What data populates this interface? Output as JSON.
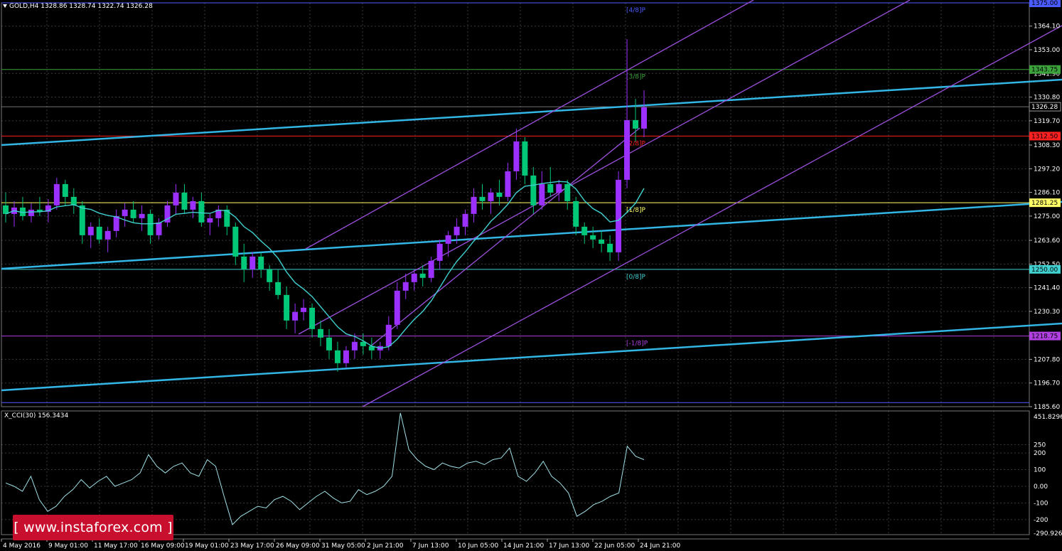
{
  "header": {
    "symbol_info": "GOLD,H4  1328.86 1328.74 1322.74 1326.28"
  },
  "indicator": {
    "label": "X_CCI(30) 156.3434"
  },
  "watermark": {
    "text": "[ www.instaforex.com ]"
  },
  "colors": {
    "background": "#000000",
    "grid": "#3a3a3a",
    "bull": "#9b30ff",
    "bear": "#00c878",
    "ma": "#40d0d0",
    "trend": "#33b5e5",
    "channel": "#9b4fdb",
    "cci": "#9fe0e8"
  },
  "chart_data": [
    {
      "type": "candlestick",
      "ylim": [
        1185.6,
        1375.0
      ],
      "price_ticks": [
        "1364.10",
        "1353.00",
        "1341.90",
        "1330.80",
        "1319.70",
        "1308.30",
        "1297.20",
        "1286.10",
        "1275.00",
        "1263.60",
        "1252.50",
        "1241.40",
        "1230.30",
        "1207.80",
        "1196.70",
        "1185.60"
      ],
      "time_ticks": [
        "4 May 2016",
        "9 May 01:00",
        "11 May 17:00",
        "16 May 09:00",
        "19 May 01:00",
        "23 May 17:00",
        "26 May 09:00",
        "31 May 05:00",
        "2 Jun 21:00",
        "7 Jun 13:00",
        "10 Jun 05:00",
        "14 Jun 21:00",
        "17 Jun 13:00",
        "22 Jun 05:00",
        "24 Jun 21:00"
      ],
      "current_price": {
        "value": 1326.28,
        "label": "1326.28"
      },
      "levels": [
        {
          "value": 1375.0,
          "label": "1375.00",
          "tag": "[4/8]P",
          "color": "#4a5bff"
        },
        {
          "value": 1343.75,
          "label": "1343.75",
          "tag": "[3/8]P",
          "color": "#3ca33c"
        },
        {
          "value": 1312.5,
          "label": "1312.50",
          "tag": "[2/8]P",
          "color": "#ff2020"
        },
        {
          "value": 1281.25,
          "label": "1281.25",
          "tag": "[1/8]P",
          "color": "#ffff66"
        },
        {
          "value": 1250.0,
          "label": "1250.00",
          "tag": "[0/8]P",
          "color": "#40d0d0"
        },
        {
          "value": 1218.75,
          "label": "1218.75",
          "tag": "[-1/8]P",
          "color": "#b040e0"
        },
        {
          "value": 1187.5,
          "label": "",
          "tag": "",
          "color": "#4a5bff"
        }
      ],
      "series": [
        {
          "points": [
            [
              1280,
              1286,
              1272,
              1276
            ],
            [
              1276,
              1282,
              1270,
              1279
            ],
            [
              1279,
              1284,
              1273,
              1275
            ],
            [
              1275,
              1281,
              1272,
              1278
            ],
            [
              1278,
              1284,
              1275,
              1277
            ],
            [
              1277,
              1283,
              1272,
              1280
            ],
            [
              1280,
              1293,
              1278,
              1290
            ],
            [
              1290,
              1292,
              1280,
              1284
            ],
            [
              1284,
              1288,
              1276,
              1280
            ],
            [
              1280,
              1282,
              1262,
              1266
            ],
            [
              1266,
              1272,
              1260,
              1270
            ],
            [
              1270,
              1274,
              1262,
              1264
            ],
            [
              1264,
              1270,
              1258,
              1268
            ],
            [
              1268,
              1278,
              1265,
              1275
            ],
            [
              1275,
              1281,
              1270,
              1278
            ],
            [
              1278,
              1282,
              1272,
              1274
            ],
            [
              1274,
              1280,
              1268,
              1276
            ],
            [
              1276,
              1278,
              1262,
              1266
            ],
            [
              1266,
              1274,
              1264,
              1272
            ],
            [
              1272,
              1282,
              1270,
              1280
            ],
            [
              1280,
              1290,
              1276,
              1286
            ],
            [
              1286,
              1290,
              1276,
              1278
            ],
            [
              1278,
              1284,
              1274,
              1282
            ],
            [
              1282,
              1286,
              1270,
              1272
            ],
            [
              1272,
              1276,
              1266,
              1274
            ],
            [
              1274,
              1280,
              1270,
              1278
            ],
            [
              1278,
              1280,
              1266,
              1270
            ],
            [
              1270,
              1272,
              1252,
              1256
            ],
            [
              1256,
              1262,
              1244,
              1250
            ],
            [
              1250,
              1258,
              1246,
              1256
            ],
            [
              1256,
              1258,
              1246,
              1250
            ],
            [
              1250,
              1252,
              1240,
              1244
            ],
            [
              1244,
              1250,
              1236,
              1238
            ],
            [
              1238,
              1242,
              1222,
              1226
            ],
            [
              1226,
              1234,
              1220,
              1230
            ],
            [
              1230,
              1236,
              1226,
              1232
            ],
            [
              1232,
              1234,
              1218,
              1222
            ],
            [
              1222,
              1226,
              1214,
              1218
            ],
            [
              1218,
              1222,
              1208,
              1212
            ],
            [
              1212,
              1216,
              1202,
              1206
            ],
            [
              1206,
              1214,
              1204,
              1212
            ],
            [
              1212,
              1220,
              1208,
              1216
            ],
            [
              1216,
              1220,
              1210,
              1214
            ],
            [
              1214,
              1218,
              1208,
              1212
            ],
            [
              1212,
              1216,
              1208,
              1214
            ],
            [
              1214,
              1228,
              1212,
              1224
            ],
            [
              1224,
              1244,
              1222,
              1240
            ],
            [
              1240,
              1248,
              1236,
              1244
            ],
            [
              1244,
              1250,
              1240,
              1248
            ],
            [
              1248,
              1252,
              1242,
              1246
            ],
            [
              1246,
              1256,
              1244,
              1254
            ],
            [
              1254,
              1264,
              1250,
              1262
            ],
            [
              1262,
              1268,
              1256,
              1266
            ],
            [
              1266,
              1274,
              1262,
              1270
            ],
            [
              1270,
              1278,
              1266,
              1276
            ],
            [
              1276,
              1288,
              1272,
              1284
            ],
            [
              1284,
              1290,
              1278,
              1282
            ],
            [
              1282,
              1288,
              1276,
              1286
            ],
            [
              1286,
              1292,
              1280,
              1284
            ],
            [
              1284,
              1300,
              1282,
              1296
            ],
            [
              1296,
              1316,
              1292,
              1310
            ],
            [
              1310,
              1312,
              1290,
              1294
            ],
            [
              1294,
              1298,
              1276,
              1280
            ],
            [
              1280,
              1296,
              1278,
              1290
            ],
            [
              1290,
              1298,
              1284,
              1286
            ],
            [
              1286,
              1292,
              1282,
              1290
            ],
            [
              1290,
              1292,
              1278,
              1282
            ],
            [
              1282,
              1284,
              1266,
              1270
            ],
            [
              1270,
              1272,
              1262,
              1266
            ],
            [
              1266,
              1270,
              1260,
              1264
            ],
            [
              1264,
              1268,
              1258,
              1262
            ],
            [
              1262,
              1266,
              1254,
              1258
            ],
            [
              1258,
              1296,
              1254,
              1292
            ],
            [
              1292,
              1358,
              1288,
              1320
            ],
            [
              1320,
              1330,
              1310,
              1316
            ],
            [
              1316,
              1334,
              1312,
              1326
            ]
          ]
        }
      ]
    },
    {
      "type": "line",
      "name": "X_CCI(30) 156.3434",
      "ylim": [
        -290,
        452
      ],
      "ticks": [
        "451.8296",
        "250",
        "200",
        "100",
        "0.00",
        "-100",
        "-200",
        "-290.9265"
      ],
      "guide_levels": [
        250,
        200,
        100,
        0,
        -100,
        -200
      ],
      "values": [
        20,
        0,
        -30,
        60,
        -80,
        -150,
        -120,
        -60,
        -20,
        40,
        -10,
        30,
        60,
        0,
        20,
        40,
        80,
        190,
        120,
        80,
        120,
        140,
        80,
        60,
        160,
        120,
        -60,
        -230,
        -180,
        -150,
        -120,
        -130,
        -80,
        -60,
        -90,
        -140,
        -100,
        -60,
        -30,
        -70,
        -100,
        -90,
        -20,
        -50,
        -30,
        0,
        60,
        440,
        220,
        160,
        120,
        100,
        140,
        120,
        110,
        140,
        150,
        130,
        160,
        170,
        230,
        60,
        30,
        80,
        150,
        60,
        20,
        -40,
        -180,
        -150,
        -110,
        -90,
        -60,
        -40,
        240,
        180,
        160
      ]
    }
  ]
}
